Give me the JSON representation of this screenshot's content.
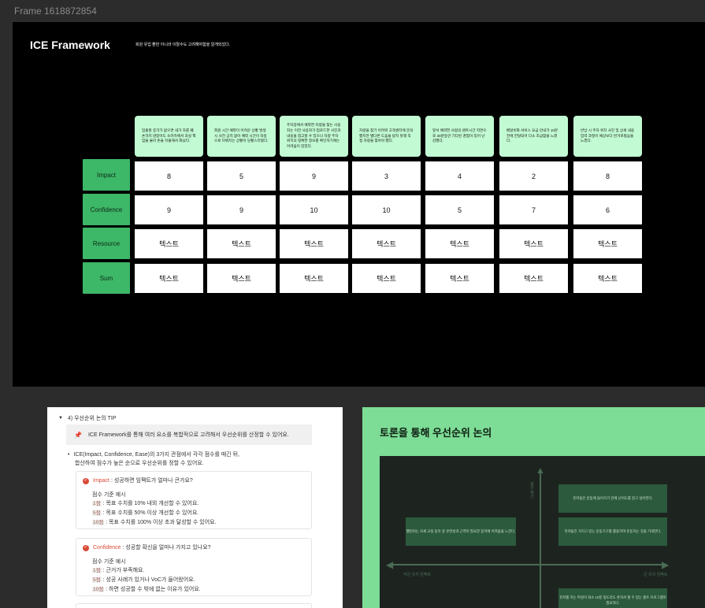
{
  "frame_label": "Frame 1618872854",
  "ice": {
    "title": "ICE Framework",
    "subtitle": "회원 유입 뿐만 아니라 이탈수도 고려해야함을 알게되었다.",
    "row_labels": [
      "Impact",
      "Confidence",
      "Resource",
      "Sum"
    ],
    "cards": [
      "입출할 증거가 없으면 내가 차를 훼손하지 않았어도 쏘카측에서 과실 책임을 물어 돈을 지불해서 화났다.",
      "회원 시간 예약이 어려운 상황 발생 시 사전 공지 없이 예약 시간이 자동으로 미뤄지는 상황이 당황스러웠다.",
      "주차장에서 예약한 차량을 찾는 사용자는 이전 사용자가 업로드한 사진과 내용을 참고할 수 있으나 차량 주차 위치의 정확한 정보를 확인하기에는 어려움이 있었다.",
      "차량을 찾기 어려워 고객센터에 문의했지만 별다른 도움을 받지 못해 직접 차량을 찾아야 했다.",
      "앞서 예약한 사람의 렌트시간 지연으로 30분동안 기다린 경험이 있어 난감했다.",
      "배달비와 서비스 요금 안내가 10분 전에 전달되어 다소 조급함을 느꼈다.",
      "반납 시 주차 위치 사진 및 상세 내용 입력 과정이 예상보다 번거로웠음을 느꼈다."
    ],
    "impact": [
      "8",
      "5",
      "9",
      "3",
      "4",
      "2",
      "8"
    ],
    "confidence": [
      "9",
      "9",
      "10",
      "10",
      "5",
      "7",
      "6"
    ],
    "resource": [
      "텍스트",
      "텍스트",
      "텍스트",
      "텍스트",
      "텍스트",
      "텍스트",
      "텍스트"
    ],
    "sum": [
      "텍스트",
      "텍스트",
      "텍스트",
      "텍스트",
      "텍스트",
      "텍스트",
      "텍스트"
    ]
  },
  "tips": {
    "toggle_title": "4) 우선순위 논의 TIP",
    "callout": "ICE Framework를 통해 여러 요소를 복합적으로 고려해서 우선순위를 산정할 수 있어요.",
    "bullet_line1": "ICE(Impact, Confidence, Ease)의 3가지 관점에서 각각 점수를 매긴 뒤,",
    "bullet_line2": "합산하여 점수가 높은 순으로 우선순위를 정할 수 있어요.",
    "criteria": [
      {
        "name": "Impact",
        "question": " : 성공하면 임팩트가 얼마나 큰가요?",
        "example_title": "점수 기준 예시",
        "lines": [
          {
            "score": "1점",
            "text": " : 목표 수치를 10% 내외 개선할 수 있어요."
          },
          {
            "score": "5점",
            "text": " : 목표 수치를 50% 이상 개선할 수 있어요."
          },
          {
            "score": "10점",
            "text": " : 목표 수치를 100% 이상 초과 달성할 수 있어요."
          }
        ]
      },
      {
        "name": "Confidence",
        "question": " : 성공할 확신을 얼마나 가지고 있나요?",
        "example_title": "점수 기준 예시",
        "lines": [
          {
            "score": "1점",
            "text": " : 근거가 부족해요."
          },
          {
            "score": "5점",
            "text": " : 성공 사례가 있거나 VoC가 들어왔어요."
          },
          {
            "score": "10점",
            "text": " : 하면 성공할 수 밖에 없는 이유가 있어요."
          }
        ]
      }
    ]
  },
  "discussion": {
    "title": "토론을 통해 우선순위 논의",
    "axis_top": "높은 확신",
    "axis_left": "작은 유저 임팩트",
    "axis_right": "큰 유저 임팩트",
    "box_top_right": "유저들은 운동에 들어가기 전에 난이도를 알고 싶어한다.",
    "box_mid_right": "유저들은 가지고 있는 운동기구를 활용하여 운동하는 것을 기대한다.",
    "box_left": "헬린이는 자세 교정 동작 중 유연성과 근력이 필요한 동작에 어려움을 느낀다.",
    "box_bottom_right": "유저를 하는 여성이 최소 10분 정도라도 혼자서 할 수 있는 홈트 프로그램이 필요하다."
  },
  "colors": {
    "row_label_green": "#3db768",
    "card_mint": "#c2fbd3",
    "panel_green": "#7ddc95",
    "accent_red": "#d94a38"
  }
}
